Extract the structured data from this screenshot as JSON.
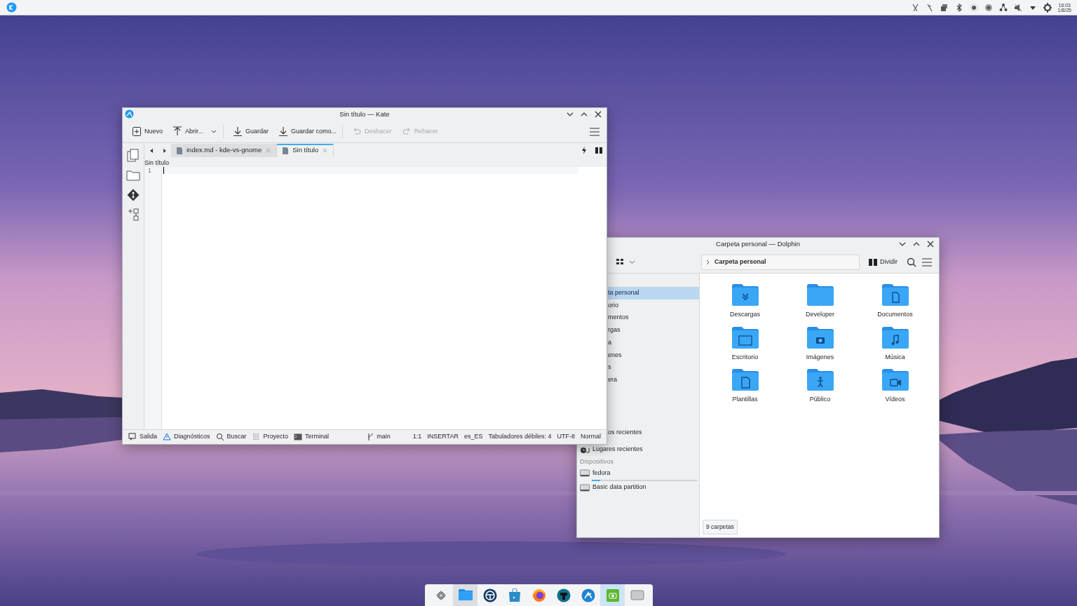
{
  "top_panel": {
    "clock_time": "16:03",
    "clock_date": "1/8/25"
  },
  "kate": {
    "title": "Sin título — Kate",
    "toolbar": [
      {
        "kind": "new",
        "label": "Nuevo",
        "disabled": false,
        "dropdown": false,
        "separator_after": false
      },
      {
        "kind": "open",
        "label": "Abrir...",
        "disabled": false,
        "dropdown": true,
        "separator_after": true
      },
      {
        "kind": "save",
        "label": "Guardar",
        "disabled": false,
        "dropdown": false,
        "separator_after": false
      },
      {
        "kind": "saveas",
        "label": "Guardar como...",
        "disabled": false,
        "dropdown": false,
        "separator_after": true
      },
      {
        "kind": "undo",
        "label": "Deshacer",
        "disabled": true,
        "dropdown": false,
        "separator_after": false
      },
      {
        "kind": "redo",
        "label": "Rehacer",
        "disabled": true,
        "dropdown": false,
        "separator_after": false
      }
    ],
    "tabs": [
      {
        "label": "index.md - kde-vs-gnome",
        "selected": false
      },
      {
        "label": "Sin título",
        "selected": true
      }
    ],
    "document_title": "Sin título",
    "line_numbers": [
      "1"
    ],
    "status_left": [
      {
        "kind": "output",
        "label": "Salida"
      },
      {
        "kind": "diagnostics",
        "label": "Diagnósticos"
      },
      {
        "kind": "search",
        "label": "Buscar"
      },
      {
        "kind": "project",
        "label": "Proyecto"
      },
      {
        "kind": "terminal",
        "label": "Terminal"
      }
    ],
    "status_right": [
      {
        "kind": "branch",
        "label": "main"
      },
      {
        "kind": "text",
        "label": "1:1"
      },
      {
        "kind": "text",
        "label": "INSERTAR"
      },
      {
        "kind": "text",
        "label": "es_ES"
      },
      {
        "kind": "text",
        "label": "Tabuladores débiles: 4"
      },
      {
        "kind": "text",
        "label": "UTF-8"
      },
      {
        "kind": "text",
        "label": "Normal"
      }
    ]
  },
  "dolphin": {
    "title": "Carpeta personal — Dolphin",
    "location": "Carpeta personal",
    "split_label": "Dividir",
    "sidebar": [
      {
        "kind": "clipped",
        "label": "ta personal",
        "selected": true
      },
      {
        "kind": "clipped",
        "label": "orio",
        "selected": false
      },
      {
        "kind": "clipped",
        "label": "mentos",
        "selected": false
      },
      {
        "kind": "clipped",
        "label": "rgas",
        "selected": false
      },
      {
        "kind": "clipped",
        "label": "a",
        "selected": false
      },
      {
        "kind": "clipped",
        "label": "enes",
        "selected": false
      },
      {
        "kind": "clipped",
        "label": "s",
        "selected": false
      },
      {
        "kind": "clipped",
        "label": "era",
        "selected": false
      },
      {
        "kind": "clipped",
        "label": "os recientes",
        "selected": false
      },
      {
        "kind": "recent",
        "label": "Lugares recientes",
        "selected": false
      },
      {
        "kind": "heading",
        "label": "Dispositivos"
      },
      {
        "kind": "drive",
        "label": "fedora",
        "selected": false,
        "level": 0.08
      },
      {
        "kind": "drive",
        "label": "Basic data partition",
        "selected": false
      }
    ],
    "folders": [
      {
        "kind": "download",
        "label": "Descargas"
      },
      {
        "kind": "plain",
        "label": "Developer"
      },
      {
        "kind": "document",
        "label": "Documentos"
      },
      {
        "kind": "desktop",
        "label": "Escritorio"
      },
      {
        "kind": "camera",
        "label": "Imágenes"
      },
      {
        "kind": "music",
        "label": "Música"
      },
      {
        "kind": "template",
        "label": "Plantillas"
      },
      {
        "kind": "public",
        "label": "Público"
      },
      {
        "kind": "video",
        "label": "Vídeos"
      }
    ],
    "status": "9 carpetas"
  },
  "taskbar": [
    {
      "kind": "launcher",
      "active": false,
      "highlighted": false
    },
    {
      "kind": "files",
      "active": true,
      "highlighted": false
    },
    {
      "kind": "wheel",
      "active": false,
      "highlighted": false
    },
    {
      "kind": "store",
      "active": false,
      "highlighted": false
    },
    {
      "kind": "browser",
      "active": false,
      "highlighted": false
    },
    {
      "kind": "robot",
      "active": false,
      "highlighted": false
    },
    {
      "kind": "kde",
      "active": false,
      "highlighted": false
    },
    {
      "kind": "camera",
      "active": false,
      "highlighted": true
    },
    {
      "kind": "window",
      "active": false,
      "highlighted": false
    }
  ]
}
